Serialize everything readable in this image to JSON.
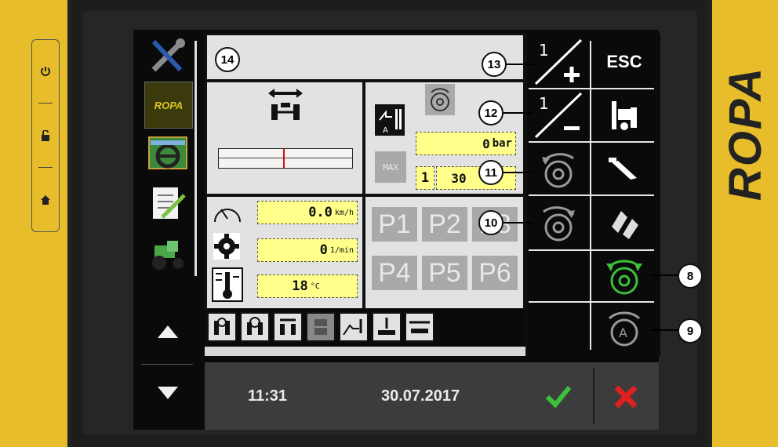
{
  "brand_text": "ROPA",
  "nav": {
    "logo_text": "ROPA"
  },
  "status": {
    "speed": "0.0",
    "speed_unit": "km/h",
    "rpm": "0",
    "rpm_unit": "1/min",
    "temp": "18",
    "temp_unit": "°C"
  },
  "pressure": {
    "value": "0",
    "unit": "bar"
  },
  "max_label": "MAX",
  "level": {
    "index": "1",
    "value": "30"
  },
  "presets": [
    "P1",
    "P2",
    "P3",
    "P4",
    "P5",
    "P6"
  ],
  "softkeys": {
    "esc_label": "ESC",
    "one_label": "1"
  },
  "bottom": {
    "time": "11:31",
    "date": "30.07.2017"
  },
  "callouts": [
    "14",
    "13",
    "12",
    "11",
    "10",
    "8",
    "9"
  ],
  "colors": {
    "bezel": "#e7bd2c",
    "accent_green": "#3cc13c",
    "cancel_red": "#e02020",
    "field_yellow": "#ffff8a"
  },
  "icons": [
    "power-icon",
    "unlock-icon",
    "home-icon",
    "wrench-screwdriver-icon",
    "steering-wheel-icon",
    "checklist-icon",
    "tractor-icon",
    "arrow-up-icon",
    "arrow-down-icon",
    "axle-shift-icon",
    "speedometer-icon",
    "gear-icon",
    "thermometer-icon",
    "rotate-plus-icon",
    "rotate-minus-icon",
    "check-icon",
    "cross-icon"
  ]
}
